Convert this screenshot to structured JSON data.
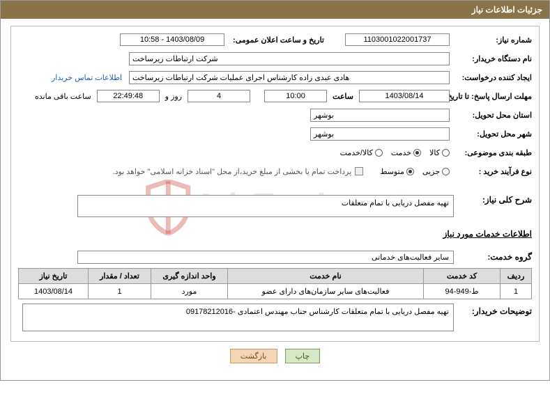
{
  "header": {
    "title": "جزئیات اطلاعات نیاز"
  },
  "fields": {
    "need_no_label": "شماره نیاز:",
    "need_no": "1103001022001737",
    "announce_label": "تاریخ و ساعت اعلان عمومی:",
    "announce_value": "1403/08/09 - 10:58",
    "buyer_org_label": "نام دستگاه خریدار:",
    "buyer_org": "شرکت ارتباطات زیرساخت",
    "requester_label": "ایجاد کننده درخواست:",
    "requester": "هادی عبدی زاده کارشناس اجرای عملیات شرکت ارتباطات زیرساخت",
    "contact_link": "اطلاعات تماس خریدار",
    "deadline_label": "مهلت ارسال پاسخ: تا تاریخ:",
    "deadline_date": "1403/08/14",
    "time_label": "ساعت",
    "deadline_time": "10:00",
    "days": "4",
    "days_and": "روز و",
    "countdown": "22:49:48",
    "remaining": "ساعت باقی مانده",
    "province_label": "استان محل تحویل:",
    "province": "بوشهر",
    "city_label": "شهر محل تحویل:",
    "city": "بوشهر",
    "category_label": "طبقه بندی موضوعی:",
    "cat_goods": "کالا",
    "cat_service": "خدمت",
    "cat_goods_service": "کالا/خدمت",
    "proc_type_label": "نوع فرآیند خرید :",
    "proc_small": "جزیی",
    "proc_medium": "متوسط",
    "payment_note": "پرداخت تمام یا بخشی از مبلغ خرید،از محل \"اسناد خزانه اسلامی\" خواهد بود.",
    "summary_label": "شرح کلی نیاز:",
    "summary": "تهیه مفصل دریایی با تمام متعلقات",
    "services_header": "اطلاعات خدمات مورد نیاز",
    "service_group_label": "گروه خدمت:",
    "service_group": "سایر فعالیت‌های خدماتی",
    "buyer_notes_label": "توضیحات خریدار:",
    "buyer_notes": "تهیه مفصل دریایی با تمام متعلقات کارشناس جناب مهندس اعتمادی -09178212016"
  },
  "table": {
    "headers": {
      "row": "ردیف",
      "code": "کد خدمت",
      "name": "نام خدمت",
      "unit": "واحد اندازه گیری",
      "qty": "تعداد / مقدار",
      "date": "تاریخ نیاز"
    },
    "rows": [
      {
        "row": "1",
        "code": "ط-949-94",
        "name": "فعالیت‌های سایر سازمان‌های دارای عضو",
        "unit": "مورد",
        "qty": "1",
        "date": "1403/08/14"
      }
    ]
  },
  "buttons": {
    "print": "چاپ",
    "back": "بازگشت"
  },
  "watermark": {
    "text": "AriaTender.net"
  }
}
